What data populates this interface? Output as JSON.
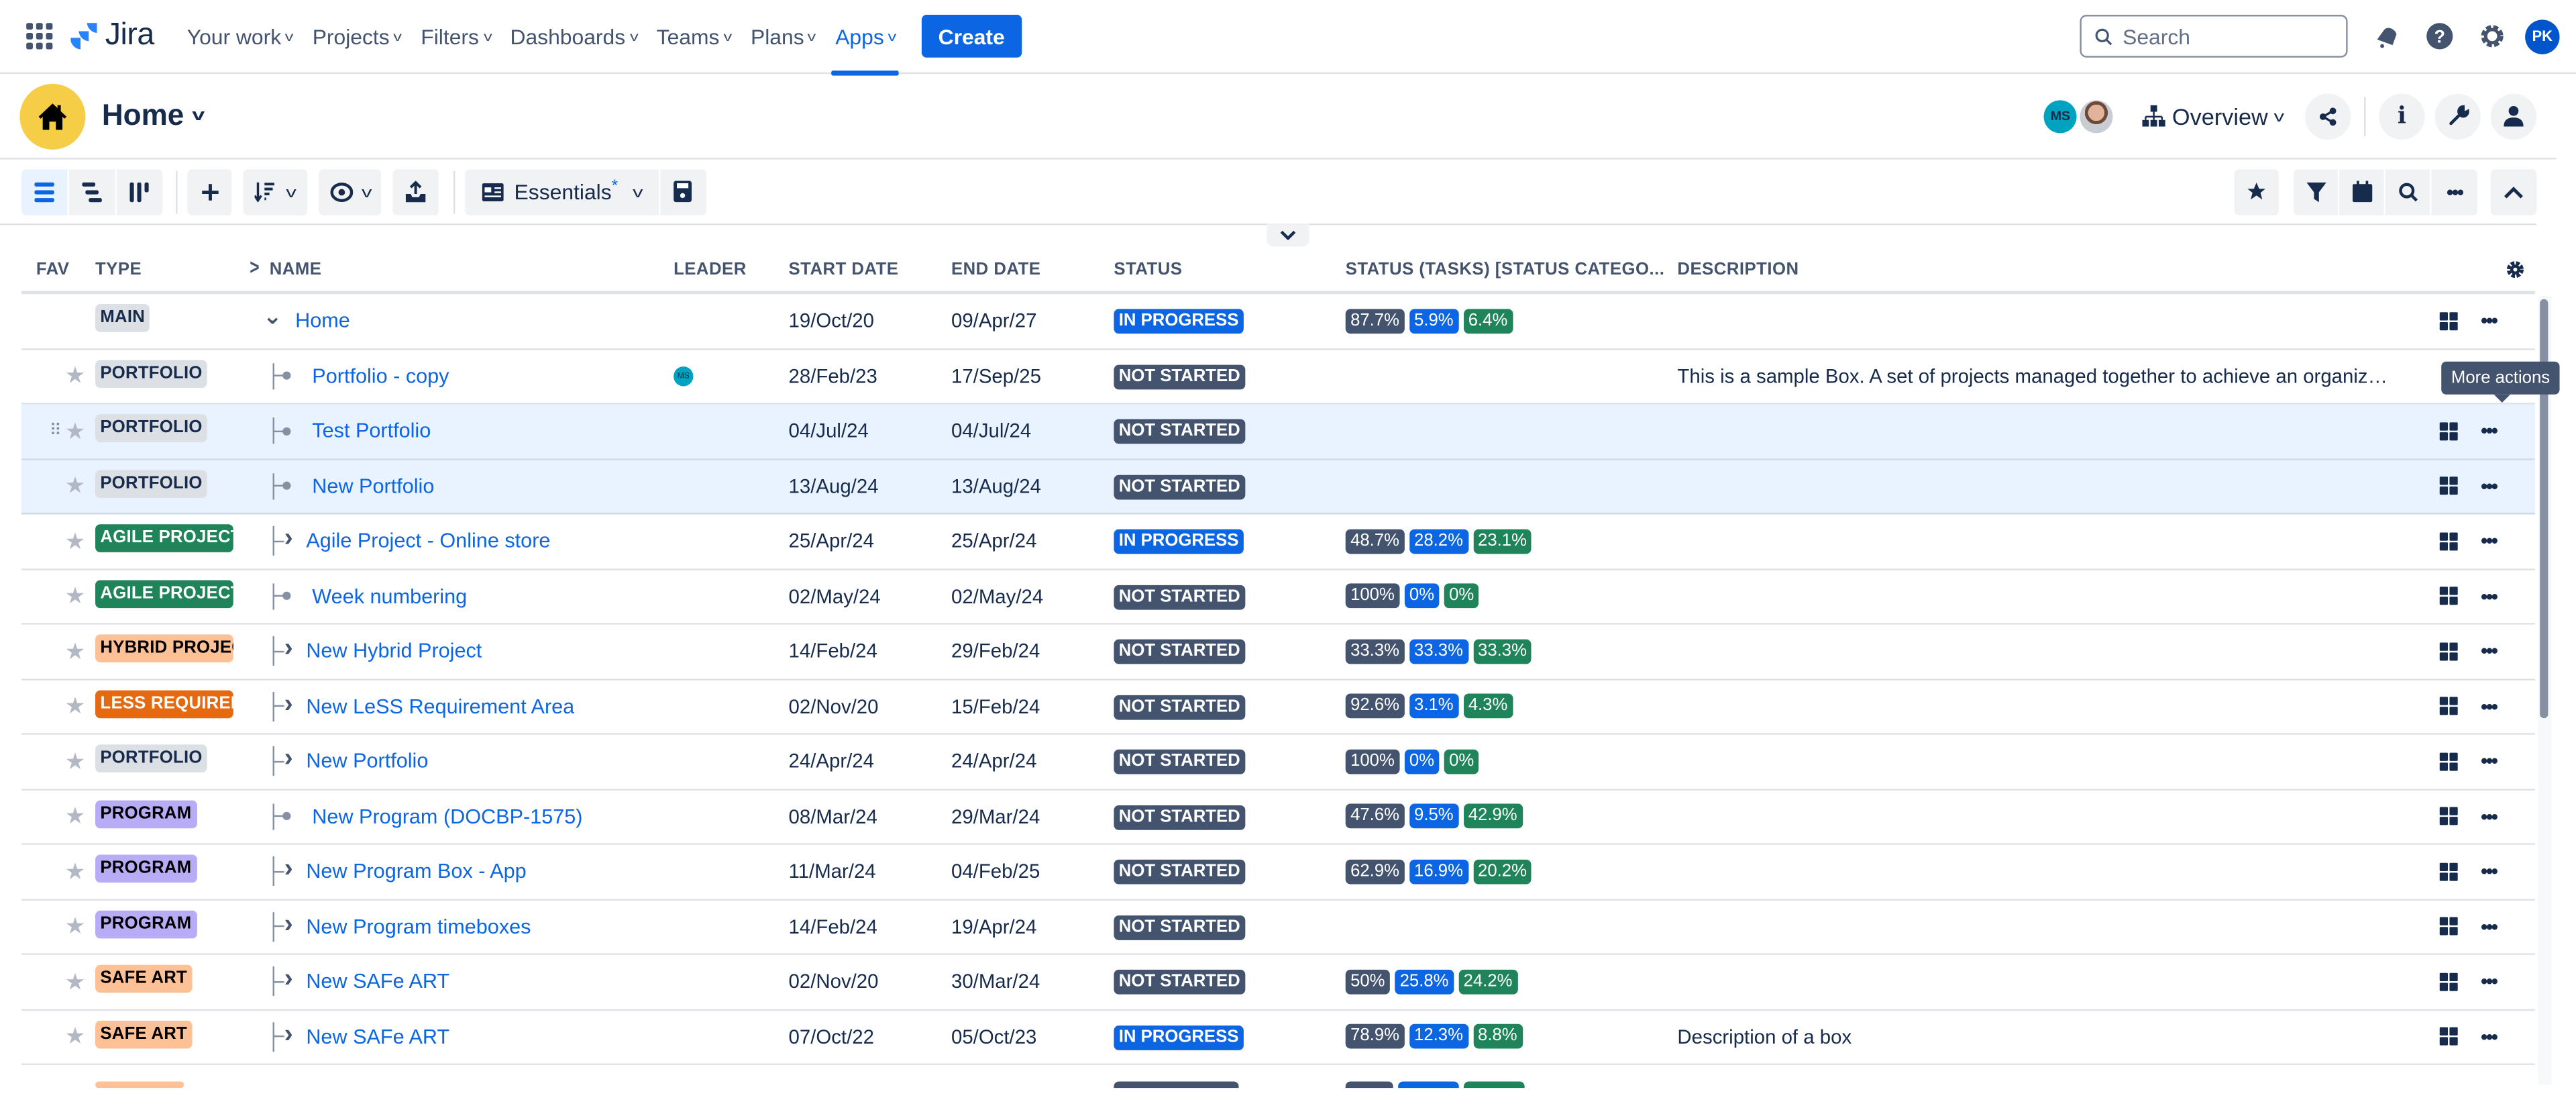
{
  "topnav": {
    "app_name": "Jira",
    "items": [
      {
        "label": "Your work"
      },
      {
        "label": "Projects"
      },
      {
        "label": "Filters"
      },
      {
        "label": "Dashboards"
      },
      {
        "label": "Teams"
      },
      {
        "label": "Plans"
      },
      {
        "label": "Apps",
        "active": true
      }
    ],
    "create_label": "Create",
    "search_placeholder": "Search",
    "user_initials": "PK",
    "icons": [
      "notifications-icon",
      "help-icon",
      "settings-icon"
    ]
  },
  "page_header": {
    "title": "Home",
    "viewer_initials": "MS",
    "view_selector": "Overview"
  },
  "toolbar": {
    "view_preset": "Essentials",
    "view_preset_modified": "*",
    "collapse_tooltip": ""
  },
  "table": {
    "columns": {
      "fav": "FAV",
      "type": "TYPE",
      "name": "NAME",
      "leader": "LEADER",
      "start": "START DATE",
      "end": "END DATE",
      "status": "STATUS",
      "tasks": "STATUS (TASKS) [STATUS CATEGO...",
      "desc": "DESCRIPTION"
    },
    "rows": [
      {
        "type": "MAIN",
        "type_style": "main",
        "name": "Home",
        "tree": "expanded",
        "leader": "",
        "start": "19/Oct/20",
        "end": "09/Apr/27",
        "status": "IN PROGRESS",
        "tasks": [
          "87.7%",
          "5.9%",
          "6.4%"
        ],
        "desc": "",
        "fav": false
      },
      {
        "type": "PORTFOLIO",
        "type_style": "portfolio",
        "name": "Portfolio - copy",
        "tree": "leaf",
        "leader": "MS",
        "start": "28/Feb/23",
        "end": "17/Sep/25",
        "status": "NOT STARTED",
        "tasks": [],
        "desc": "This is a sample Box. A set of projects managed together to achieve an organizati...",
        "fav": true
      },
      {
        "type": "PORTFOLIO",
        "type_style": "portfolio",
        "name": "Test Portfolio",
        "tree": "leaf",
        "leader": "",
        "start": "04/Jul/24",
        "end": "04/Jul/24",
        "status": "NOT STARTED",
        "tasks": [],
        "desc": "",
        "fav": true,
        "highlighted": true,
        "drag": true
      },
      {
        "type": "PORTFOLIO",
        "type_style": "portfolio",
        "name": "New Portfolio",
        "tree": "leaf",
        "leader": "",
        "start": "13/Aug/24",
        "end": "13/Aug/24",
        "status": "NOT STARTED",
        "tasks": [],
        "desc": "",
        "fav": true,
        "highlighted": true
      },
      {
        "type": "AGILE PROJECT",
        "type_style": "agile",
        "name": "Agile Project - Online store",
        "tree": "collapsed",
        "leader": "",
        "start": "25/Apr/24",
        "end": "25/Apr/24",
        "status": "IN PROGRESS",
        "tasks": [
          "48.7%",
          "28.2%",
          "23.1%"
        ],
        "desc": "",
        "fav": true
      },
      {
        "type": "AGILE PROJECT",
        "type_style": "agile",
        "name": "Week numbering",
        "tree": "leaf",
        "leader": "",
        "start": "02/May/24",
        "end": "02/May/24",
        "status": "NOT STARTED",
        "tasks": [
          "100%",
          "0%",
          "0%"
        ],
        "desc": "",
        "fav": true
      },
      {
        "type": "HYBRID PROJEC",
        "type_style": "hybrid",
        "name": "New Hybrid Project",
        "tree": "collapsed",
        "leader": "",
        "start": "14/Feb/24",
        "end": "29/Feb/24",
        "status": "NOT STARTED",
        "tasks": [
          "33.3%",
          "33.3%",
          "33.3%"
        ],
        "desc": "",
        "fav": true
      },
      {
        "type": "LESS REQUIREM",
        "type_style": "less",
        "name": "New LeSS Requirement Area",
        "tree": "collapsed",
        "leader": "",
        "start": "02/Nov/20",
        "end": "15/Feb/24",
        "status": "NOT STARTED",
        "tasks": [
          "92.6%",
          "3.1%",
          "4.3%"
        ],
        "desc": "",
        "fav": true
      },
      {
        "type": "PORTFOLIO",
        "type_style": "portfolio",
        "name": "New Portfolio",
        "tree": "collapsed",
        "leader": "",
        "start": "24/Apr/24",
        "end": "24/Apr/24",
        "status": "NOT STARTED",
        "tasks": [
          "100%",
          "0%",
          "0%"
        ],
        "desc": "",
        "fav": true
      },
      {
        "type": "PROGRAM",
        "type_style": "program",
        "name": "New Program (DOCBP-1575)",
        "tree": "leaf",
        "leader": "",
        "start": "08/Mar/24",
        "end": "29/Mar/24",
        "status": "NOT STARTED",
        "tasks": [
          "47.6%",
          "9.5%",
          "42.9%"
        ],
        "desc": "",
        "fav": true
      },
      {
        "type": "PROGRAM",
        "type_style": "program",
        "name": "New Program Box - App",
        "tree": "collapsed",
        "leader": "",
        "start": "11/Mar/24",
        "end": "04/Feb/25",
        "status": "NOT STARTED",
        "tasks": [
          "62.9%",
          "16.9%",
          "20.2%"
        ],
        "desc": "",
        "fav": true
      },
      {
        "type": "PROGRAM",
        "type_style": "program",
        "name": "New Program timeboxes",
        "tree": "collapsed",
        "leader": "",
        "start": "14/Feb/24",
        "end": "19/Apr/24",
        "status": "NOT STARTED",
        "tasks": [],
        "desc": "",
        "fav": true
      },
      {
        "type": "SAFE ART",
        "type_style": "safe",
        "name": "New SAFe ART",
        "tree": "collapsed",
        "leader": "",
        "start": "02/Nov/20",
        "end": "30/Mar/24",
        "status": "NOT STARTED",
        "tasks": [
          "50%",
          "25.8%",
          "24.2%"
        ],
        "desc": "",
        "fav": true
      },
      {
        "type": "SAFE ART",
        "type_style": "safe",
        "name": "New SAFe ART",
        "tree": "collapsed",
        "leader": "",
        "start": "07/Oct/22",
        "end": "05/Oct/23",
        "status": "IN PROGRESS",
        "tasks": [
          "78.9%",
          "12.3%",
          "8.8%"
        ],
        "desc": "Description of a box",
        "fav": true
      }
    ]
  },
  "tooltip": "More actions",
  "colors": {
    "brand": "#0c66e4",
    "status_in_progress": "#0c66e4",
    "status_not_started": "#44546f",
    "task_todo": "#44546f",
    "task_in_progress": "#0c66e4",
    "task_done": "#1f845a",
    "type_main": "#dcdfe4",
    "type_portfolio": "#dcdfe4",
    "type_agile": "#1f845a",
    "type_hybrid": "#fec195",
    "type_less": "#e56910",
    "type_program": "#b8acf6",
    "type_safe": "#fec195",
    "home_badge": "#f5cd47"
  }
}
